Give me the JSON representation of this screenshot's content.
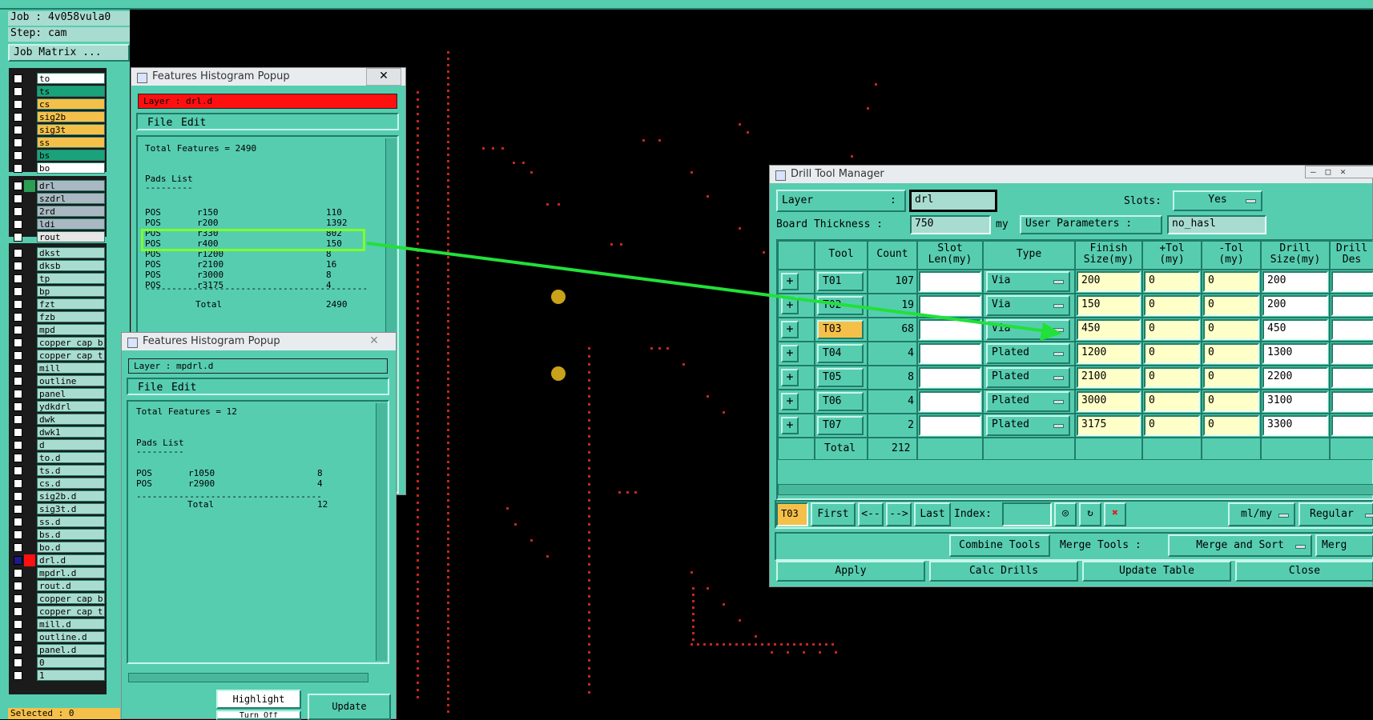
{
  "job": {
    "job_line": "Job : 4v058vula0",
    "step_line": "Step: cam",
    "matrix_button": "Job Matrix ..."
  },
  "layers_group1": [
    {
      "name": "to",
      "color": "#ffffff"
    },
    {
      "name": "ts",
      "color": "#1aa37a"
    },
    {
      "name": "cs",
      "color": "#f5c04a"
    },
    {
      "name": "sig2b",
      "color": "#f5c04a"
    },
    {
      "name": "sig3t",
      "color": "#f5c04a"
    },
    {
      "name": "ss",
      "color": "#f5c04a"
    },
    {
      "name": "bs",
      "color": "#1aa37a"
    },
    {
      "name": "bo",
      "color": "#ffffff"
    }
  ],
  "layers_group2": [
    {
      "name": "drl",
      "color": "#a9b8c2"
    },
    {
      "name": "szdrl",
      "color": "#a9b8c2"
    },
    {
      "name": "2rd",
      "color": "#a9b8c2"
    },
    {
      "name": "ldi",
      "color": "#a9b8c2"
    },
    {
      "name": "rout",
      "color": "#e6e6e6"
    }
  ],
  "layers_group3": [
    "dkst",
    "dksb",
    "tp",
    "bp",
    "fzt",
    "fzb",
    "mpd",
    "copper_cap_b",
    "copper_cap_t",
    "mill",
    "outline",
    "panel",
    "ydkdrl",
    "dwk",
    "dwk1",
    "d",
    "to.d",
    "ts.d",
    "cs.d",
    "sig2b.d",
    "sig3t.d",
    "ss.d",
    "bs.d",
    "bo.d",
    "drl.d",
    "mpdrl.d",
    "rout.d",
    "copper_cap_b",
    "copper_cap_t",
    "mill.d",
    "outline.d",
    "panel.d",
    "0",
    "1"
  ],
  "left_footer": "Selected : 0",
  "hist1": {
    "title": "Features Histogram Popup",
    "close": "✕",
    "layer": "Layer :  drl.d",
    "menu_file": "File",
    "menu_edit": "Edit",
    "total_features": "Total Features = 2490",
    "pads_list": "Pads List",
    "rows": [
      {
        "type": "POS",
        "sym": "r150",
        "count": "110"
      },
      {
        "type": "POS",
        "sym": "r200",
        "count": "1392"
      },
      {
        "type": "POS",
        "sym": "r330",
        "count": "802"
      },
      {
        "type": "POS",
        "sym": "r400",
        "count": "150"
      },
      {
        "type": "POS",
        "sym": "r1200",
        "count": "8"
      },
      {
        "type": "POS",
        "sym": "r2100",
        "count": "16"
      },
      {
        "type": "POS",
        "sym": "r3000",
        "count": "8"
      },
      {
        "type": "POS",
        "sym": "r3175",
        "count": "4"
      }
    ],
    "total_label": "Total",
    "total_value": "2490"
  },
  "hist2": {
    "title": "Features Histogram Popup",
    "close": "✕",
    "layer": "Layer :  mpdrl.d",
    "menu_file": "File",
    "menu_edit": "Edit",
    "total_features": "Total Features = 12",
    "pads_list": "Pads List",
    "rows": [
      {
        "type": "POS",
        "sym": "r1050",
        "count": "8"
      },
      {
        "type": "POS",
        "sym": "r2900",
        "count": "4"
      }
    ],
    "total_label": "Total",
    "total_value": "12",
    "highlight": "Highlight",
    "update": "Update",
    "turn_off": "Turn Off"
  },
  "dtm": {
    "title": "Drill Tool Manager",
    "layer_label": "Layer",
    "layer_value": "drl",
    "slots_label": "Slots:",
    "slots_value": "Yes",
    "thickness_label": "Board Thickness :",
    "thickness_value": "750",
    "thickness_unit": "my",
    "user_params_label": "User Parameters :",
    "user_params_value": "no_hasl",
    "headers": {
      "tool": "Tool",
      "count": "Count",
      "slot": "Slot\nLen(my)",
      "type": "Type",
      "finish": "Finish\nSize(my)",
      "ptol": "+Tol\n(my)",
      "mtol": "-Tol\n(my)",
      "drill": "Drill\nSize(my)",
      "des": "Drill\nDes"
    },
    "rows": [
      {
        "tool": "T01",
        "count": "107",
        "type": "Via",
        "finish": "200",
        "ptol": "0",
        "mtol": "0",
        "drill": "200"
      },
      {
        "tool": "T02",
        "count": "19",
        "type": "Via",
        "finish": "150",
        "ptol": "0",
        "mtol": "0",
        "drill": "200"
      },
      {
        "tool": "T03",
        "count": "68",
        "type": "Via",
        "finish": "450",
        "ptol": "0",
        "mtol": "0",
        "drill": "450"
      },
      {
        "tool": "T04",
        "count": "4",
        "type": "Plated",
        "finish": "1200",
        "ptol": "0",
        "mtol": "0",
        "drill": "1300"
      },
      {
        "tool": "T05",
        "count": "8",
        "type": "Plated",
        "finish": "2100",
        "ptol": "0",
        "mtol": "0",
        "drill": "2200"
      },
      {
        "tool": "T06",
        "count": "4",
        "type": "Plated",
        "finish": "3000",
        "ptol": "0",
        "mtol": "0",
        "drill": "3100"
      },
      {
        "tool": "T07",
        "count": "2",
        "type": "Plated",
        "finish": "3175",
        "ptol": "0",
        "mtol": "0",
        "drill": "3300"
      }
    ],
    "total_label": "Total",
    "total_value": "212",
    "nav_current": "T03",
    "nav_first": "First",
    "nav_prev": "<--",
    "nav_next": "-->",
    "nav_last": "Last",
    "index_label": "Index:",
    "units": "ml/my",
    "mode": "Regular",
    "combine": "Combine Tools",
    "merge_label": "Merge Tools :",
    "merge_value": "Merge and Sort",
    "merge_cut": "Merg",
    "apply": "Apply",
    "calc": "Calc Drills",
    "update_table": "Update Table",
    "close": "Close"
  },
  "colors": {
    "teal": "#57cdb0",
    "highlight_box": "#7dff2a",
    "arrow": "#22e03a",
    "layer_bar": "#ff1010",
    "drill_dot": "#c8261c",
    "pad": "#c9a21a"
  }
}
